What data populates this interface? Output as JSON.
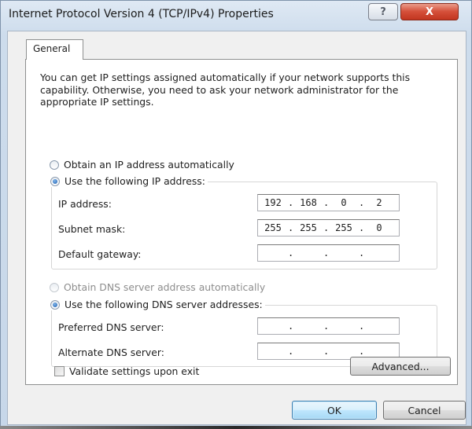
{
  "window": {
    "title": "Internet Protocol Version 4 (TCP/IPv4) Properties",
    "help_label": "?",
    "close_label": "X"
  },
  "tabs": [
    {
      "label": "General",
      "selected": true
    }
  ],
  "general": {
    "intro": "You can get IP settings assigned automatically if your network supports this capability. Otherwise, you need to ask your network administrator for the appropriate IP settings.",
    "ip_mode": {
      "auto_label": "Obtain an IP address automatically",
      "auto_selected": false,
      "manual_label": "Use the following IP address:",
      "manual_selected": true
    },
    "ip_fields": {
      "ip_address": {
        "label": "IP address:",
        "octets": [
          "192",
          "168",
          "0",
          "2"
        ]
      },
      "subnet_mask": {
        "label": "Subnet mask:",
        "octets": [
          "255",
          "255",
          "255",
          "0"
        ]
      },
      "default_gateway": {
        "label": "Default gateway:",
        "octets": [
          "",
          "",
          "",
          ""
        ]
      }
    },
    "dns_mode": {
      "auto_label": "Obtain DNS server address automatically",
      "auto_selected": false,
      "auto_disabled": true,
      "manual_label": "Use the following DNS server addresses:",
      "manual_selected": true
    },
    "dns_fields": {
      "preferred": {
        "label": "Preferred DNS server:",
        "octets": [
          "",
          "",
          "",
          ""
        ]
      },
      "alternate": {
        "label": "Alternate DNS server:",
        "octets": [
          "",
          "",
          "",
          ""
        ]
      }
    },
    "validate": {
      "label": "Validate settings upon exit",
      "checked": false
    },
    "advanced_button": "Advanced..."
  },
  "footer": {
    "ok_label": "OK",
    "cancel_label": "Cancel"
  }
}
